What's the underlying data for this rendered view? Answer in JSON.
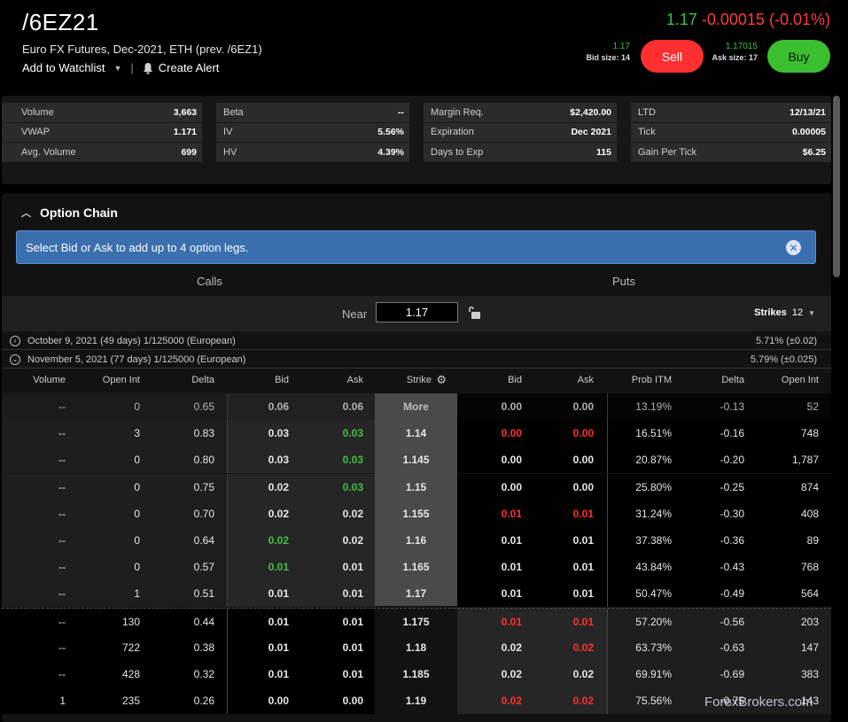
{
  "header": {
    "symbol": "/6EZ21",
    "description": "Euro FX Futures, Dec-2021, ETH (prev. /6EZ1)",
    "add_watchlist": "Add to Watchlist",
    "create_alert": "Create Alert",
    "last": "1.17",
    "change": "-0.00015 (-0.01%)",
    "bid_value": "1.17",
    "bid_size_label": "Bid size: 14",
    "ask_value": "1.17015",
    "ask_size_label": "Ask size: 17",
    "sell_label": "Sell",
    "buy_label": "Buy"
  },
  "stats": [
    [
      {
        "k": "Volume",
        "v": "3,663"
      },
      {
        "k": "VWAP",
        "v": "1.171"
      },
      {
        "k": "Avg. Volume",
        "v": "699"
      }
    ],
    [
      {
        "k": "Beta",
        "v": "--"
      },
      {
        "k": "IV",
        "v": "5.56%"
      },
      {
        "k": "HV",
        "v": "4.39%"
      }
    ],
    [
      {
        "k": "Margin Req.",
        "v": "$2,420.00"
      },
      {
        "k": "Expiration",
        "v": "Dec 2021"
      },
      {
        "k": "Days to Exp",
        "v": "115"
      }
    ],
    [
      {
        "k": "LTD",
        "v": "12/13/21"
      },
      {
        "k": "Tick",
        "v": "0.00005"
      },
      {
        "k": "Gain Per Tick",
        "v": "$6.25"
      }
    ]
  ],
  "chain": {
    "title": "Option Chain",
    "banner": "Select Bid or Ask to add up to 4 option legs.",
    "calls_label": "Calls",
    "puts_label": "Puts",
    "near_label": "Near",
    "near_value": "1.17",
    "strikes_label": "Strikes",
    "strikes_value": "12",
    "expirations": [
      {
        "label": "October 9, 2021 (49 days) 1/125000 (European)",
        "pct": "5.71% (±0.02)",
        "icon": "›"
      },
      {
        "label": "November 5, 2021 (77 days) 1/125000 (European)",
        "pct": "5.79% (±0.025)",
        "icon": "⌄"
      }
    ],
    "columns": [
      "Volume",
      "Open Int",
      "Delta",
      "Bid",
      "Ask",
      "Strike",
      "Bid",
      "Ask",
      "Prob ITM",
      "Delta",
      "Open Int"
    ],
    "rows": [
      {
        "vol": "--",
        "oi": "0",
        "delta": "0.65",
        "bid": "0.06",
        "ask": "0.06",
        "strike": "More",
        "pbid": "0.00",
        "pask": "0.00",
        "prob": "13.19%",
        "pdelta": "-0.13",
        "poi": "52",
        "cb": "",
        "ca": "",
        "pb": "",
        "pa": ""
      },
      {
        "vol": "--",
        "oi": "3",
        "delta": "0.83",
        "bid": "0.03",
        "ask": "0.03",
        "strike": "1.14",
        "pbid": "0.00",
        "pask": "0.00",
        "prob": "16.51%",
        "pdelta": "-0.16",
        "poi": "748",
        "cb": "",
        "ca": "green",
        "pb": "red",
        "pa": "red"
      },
      {
        "vol": "--",
        "oi": "0",
        "delta": "0.80",
        "bid": "0.03",
        "ask": "0.03",
        "strike": "1.145",
        "pbid": "0.00",
        "pask": "0.00",
        "prob": "20.87%",
        "pdelta": "-0.20",
        "poi": "1,787",
        "cb": "",
        "ca": "green",
        "pb": "",
        "pa": ""
      },
      {
        "vol": "--",
        "oi": "0",
        "delta": "0.75",
        "bid": "0.02",
        "ask": "0.03",
        "strike": "1.15",
        "pbid": "0.00",
        "pask": "0.00",
        "prob": "25.80%",
        "pdelta": "-0.25",
        "poi": "874",
        "cb": "",
        "ca": "green",
        "pb": "",
        "pa": ""
      },
      {
        "vol": "--",
        "oi": "0",
        "delta": "0.70",
        "bid": "0.02",
        "ask": "0.02",
        "strike": "1.155",
        "pbid": "0.01",
        "pask": "0.01",
        "prob": "31.24%",
        "pdelta": "-0.30",
        "poi": "408",
        "cb": "",
        "ca": "",
        "pb": "red",
        "pa": "red"
      },
      {
        "vol": "--",
        "oi": "0",
        "delta": "0.64",
        "bid": "0.02",
        "ask": "0.02",
        "strike": "1.16",
        "pbid": "0.01",
        "pask": "0.01",
        "prob": "37.38%",
        "pdelta": "-0.36",
        "poi": "89",
        "cb": "green",
        "ca": "",
        "pb": "",
        "pa": ""
      },
      {
        "vol": "--",
        "oi": "0",
        "delta": "0.57",
        "bid": "0.01",
        "ask": "0.01",
        "strike": "1.165",
        "pbid": "0.01",
        "pask": "0.01",
        "prob": "43.84%",
        "pdelta": "-0.43",
        "poi": "768",
        "cb": "green",
        "ca": "",
        "pb": "",
        "pa": ""
      },
      {
        "vol": "--",
        "oi": "1",
        "delta": "0.51",
        "bid": "0.01",
        "ask": "0.01",
        "strike": "1.17",
        "pbid": "0.01",
        "pask": "0.01",
        "prob": "50.47%",
        "pdelta": "-0.49",
        "poi": "564",
        "cb": "",
        "ca": "",
        "pb": "",
        "pa": ""
      },
      {
        "vol": "--",
        "oi": "130",
        "delta": "0.44",
        "bid": "0.01",
        "ask": "0.01",
        "strike": "1.175",
        "pbid": "0.01",
        "pask": "0.01",
        "prob": "57.20%",
        "pdelta": "-0.56",
        "poi": "203",
        "cb": "",
        "ca": "",
        "pb": "red",
        "pa": "red"
      },
      {
        "vol": "--",
        "oi": "722",
        "delta": "0.38",
        "bid": "0.01",
        "ask": "0.01",
        "strike": "1.18",
        "pbid": "0.02",
        "pask": "0.02",
        "prob": "63.73%",
        "pdelta": "-0.63",
        "poi": "147",
        "cb": "",
        "ca": "",
        "pb": "",
        "pa": "red"
      },
      {
        "vol": "--",
        "oi": "428",
        "delta": "0.32",
        "bid": "0.01",
        "ask": "0.01",
        "strike": "1.185",
        "pbid": "0.02",
        "pask": "0.02",
        "prob": "69.91%",
        "pdelta": "-0.69",
        "poi": "383",
        "cb": "",
        "ca": "",
        "pb": "",
        "pa": ""
      },
      {
        "vol": "1",
        "oi": "235",
        "delta": "0.26",
        "bid": "0.00",
        "ask": "0.00",
        "strike": "1.19",
        "pbid": "0.02",
        "pask": "0.02",
        "prob": "75.56%",
        "pdelta": "-0.75",
        "poi": "143",
        "cb": "",
        "ca": "",
        "pb": "red",
        "pa": "red"
      }
    ]
  },
  "watermark": "ForexBrokers.com",
  "colors": {
    "green": "#3fbf3f",
    "red": "#ff2f2f",
    "banner": "#3a6fb0"
  }
}
